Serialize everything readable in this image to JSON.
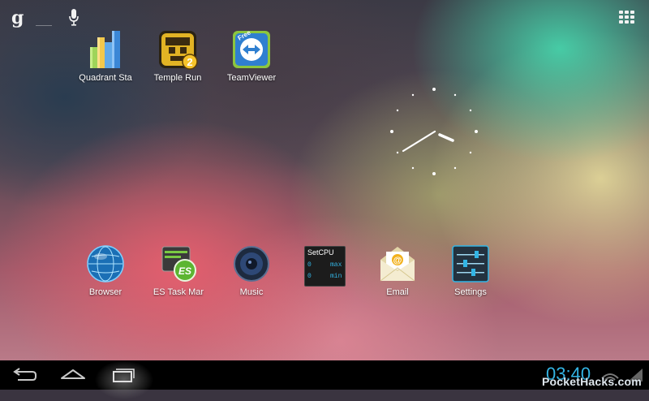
{
  "home": {
    "top_apps": [
      {
        "label": "Quadrant Sta",
        "icon": "quadrant-icon"
      },
      {
        "label": "Temple Run",
        "icon": "temple-run-icon"
      },
      {
        "label": "TeamViewer",
        "icon": "teamviewer-icon"
      }
    ],
    "dock_apps": [
      {
        "label": "Browser",
        "icon": "globe-icon"
      },
      {
        "label": "ES Task Mar",
        "icon": "es-task-manager-icon"
      },
      {
        "label": "Music",
        "icon": "speaker-icon"
      },
      {
        "label": "Email",
        "icon": "envelope-icon"
      },
      {
        "label": "Settings",
        "icon": "sliders-icon"
      }
    ],
    "setcpu_widget": {
      "title": "SetCPU",
      "max_value": "0",
      "max_label": "max",
      "min_value": "0",
      "min_label": "min"
    },
    "temple_run_badge": "2",
    "teamviewer_badge": "Free"
  },
  "search": {
    "icon": "google-g-icon",
    "g_letter": "g",
    "voice_icon": "microphone-icon"
  },
  "navbar": {
    "time": "03:40",
    "watermark": "PocketHacks.com",
    "buttons": [
      "back-icon",
      "home-icon",
      "recents-icon"
    ]
  },
  "colors": {
    "accent": "#33b5e5",
    "navbar": "#000000"
  }
}
